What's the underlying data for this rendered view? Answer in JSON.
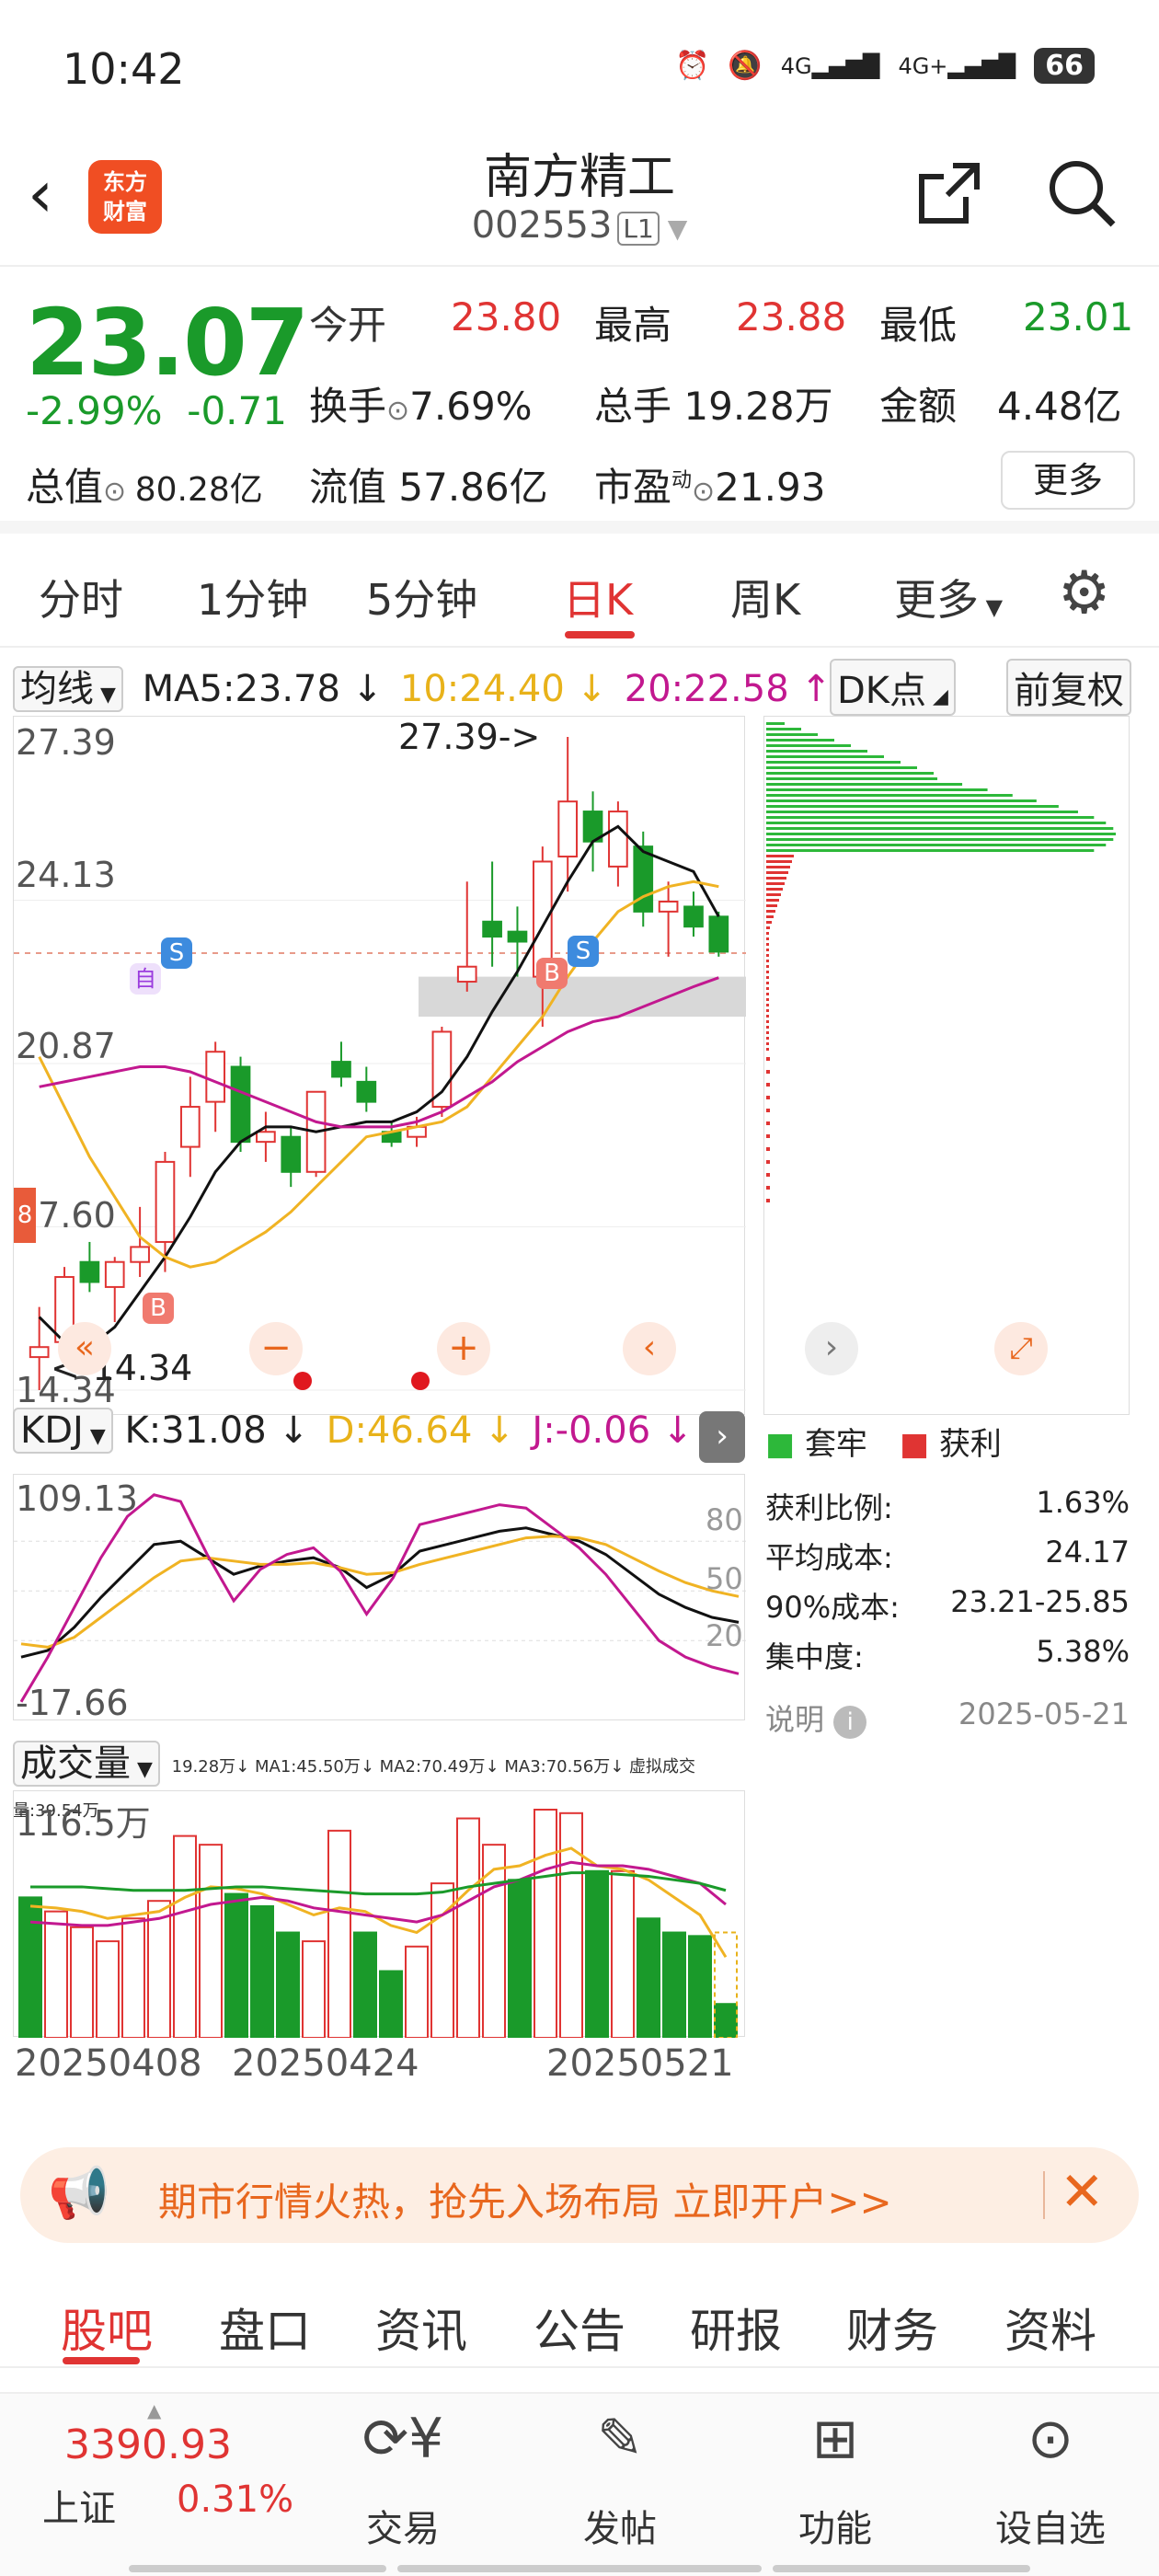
{
  "status_bar": {
    "time": "10:42",
    "signal1": "4G",
    "signal2": "4G+",
    "battery": "66"
  },
  "header": {
    "logo_text": "东方财富",
    "name": "南方精工",
    "code": "002553",
    "level": "L1"
  },
  "quote": {
    "price": "23.07",
    "change_pct": "-2.99%",
    "change": "-0.71",
    "open_label": "今开",
    "open": "23.80",
    "high_label": "最高",
    "high": "23.88",
    "low_label": "最低",
    "low": "23.01",
    "turnover_label": "换手",
    "turnover": "7.69%",
    "volume_label": "总手",
    "volume": "19.28万",
    "amount_label": "金额",
    "amount": "4.48亿",
    "mktcap_label": "总值",
    "mktcap": "80.28亿",
    "float_label": "流值",
    "float": "57.86亿",
    "pe_label": "市盈",
    "pe_sup": "动",
    "pe": "21.93",
    "more": "更多"
  },
  "tabs": [
    "分时",
    "1分钟",
    "5分钟",
    "日K",
    "周K",
    "更多"
  ],
  "active_tab": "日K",
  "ma_bar": {
    "selector": "均线",
    "ma5": "MA5:23.78 ↓",
    "ma10": "10:24.40 ↓",
    "ma20": "20:22.58 ↑",
    "dk": "DK点",
    "adjust": "前复权"
  },
  "kline": {
    "y_labels": [
      "27.39",
      "24.13",
      "20.87",
      "17.60",
      "14.34"
    ],
    "max_marker": "27.39->",
    "min_marker": "<-14.34",
    "markers": [
      "S",
      "B",
      "B",
      "S",
      "自"
    ],
    "side_label": "8"
  },
  "kdj_bar": {
    "selector": "KDJ",
    "k": "K:31.08 ↓",
    "d": "D:46.64 ↓",
    "j": "J:-0.06 ↓"
  },
  "kdj": {
    "y_top": "109.13",
    "y_bottom": "-17.66",
    "levels": [
      "80",
      "50",
      "20"
    ]
  },
  "vol_bar": {
    "selector": "成交量",
    "info": "19.28万↓  MA1:45.50万↓  MA2:70.49万↓  MA3:70.56万↓  虚拟成交量:39.54万"
  },
  "volume": {
    "y_top": "116.5万",
    "dates": [
      "20250408",
      "20250424",
      "20250521"
    ]
  },
  "chips": {
    "legend_trapped": "套牢",
    "legend_profit": "获利",
    "rows": [
      {
        "label": "获利比例:",
        "value": "1.63%"
      },
      {
        "label": "平均成本:",
        "value": "24.17"
      },
      {
        "label": "90%成本:",
        "value": "23.21-25.85"
      },
      {
        "label": "集中度:",
        "value": "5.38%"
      }
    ],
    "note_label": "说明",
    "date": "2025-05-21"
  },
  "banner": {
    "text": "期市行情火热，抢先入场布局 立即开户>>"
  },
  "bottom_tabs": [
    "股吧",
    "盘口",
    "资讯",
    "公告",
    "研报",
    "财务",
    "资料"
  ],
  "bottom_nav": {
    "index_value": "3390.93",
    "index_name": "上证",
    "index_pct": "0.31%",
    "items": [
      "交易",
      "发帖",
      "功能",
      "设自选"
    ]
  },
  "colors": {
    "up": "#e03433",
    "down": "#1a9a2a",
    "accent": "#e03433",
    "banner_text": "#e8671e"
  },
  "chart_data": {
    "type": "candlestick",
    "dates_shown": [
      "20250408",
      "20250424",
      "20250521"
    ],
    "y_range": [
      14.34,
      27.39
    ],
    "candles": [
      {
        "o": 15.2,
        "h": 16.0,
        "l": 14.34,
        "c": 15.0,
        "up": true
      },
      {
        "o": 15.3,
        "h": 16.8,
        "l": 14.9,
        "c": 16.6,
        "up": true
      },
      {
        "o": 16.9,
        "h": 17.3,
        "l": 16.3,
        "c": 16.5,
        "up": false
      },
      {
        "o": 16.4,
        "h": 17.0,
        "l": 15.7,
        "c": 16.9,
        "up": true
      },
      {
        "o": 16.9,
        "h": 18.0,
        "l": 16.6,
        "c": 17.2,
        "up": true
      },
      {
        "o": 17.3,
        "h": 19.1,
        "l": 16.7,
        "c": 18.9,
        "up": true
      },
      {
        "o": 19.2,
        "h": 20.6,
        "l": 18.6,
        "c": 20.0,
        "up": true
      },
      {
        "o": 20.1,
        "h": 21.3,
        "l": 19.5,
        "c": 21.1,
        "up": true
      },
      {
        "o": 20.8,
        "h": 21.0,
        "l": 19.1,
        "c": 19.3,
        "up": false
      },
      {
        "o": 19.3,
        "h": 19.9,
        "l": 18.9,
        "c": 19.5,
        "up": true
      },
      {
        "o": 19.4,
        "h": 19.6,
        "l": 18.4,
        "c": 18.7,
        "up": false
      },
      {
        "o": 18.7,
        "h": 20.0,
        "l": 18.6,
        "c": 20.3,
        "up": true
      },
      {
        "o": 20.9,
        "h": 21.3,
        "l": 20.4,
        "c": 20.6,
        "up": false
      },
      {
        "o": 20.5,
        "h": 20.8,
        "l": 19.9,
        "c": 20.1,
        "up": false
      },
      {
        "o": 19.5,
        "h": 19.7,
        "l": 19.2,
        "c": 19.3,
        "up": false
      },
      {
        "o": 19.4,
        "h": 19.8,
        "l": 19.2,
        "c": 19.6,
        "up": true
      },
      {
        "o": 20.0,
        "h": 21.6,
        "l": 19.8,
        "c": 21.5,
        "up": true
      },
      {
        "o": 22.5,
        "h": 24.5,
        "l": 22.3,
        "c": 22.8,
        "up": true
      },
      {
        "o": 23.7,
        "h": 24.9,
        "l": 22.8,
        "c": 23.4,
        "up": false
      },
      {
        "o": 23.3,
        "h": 24.0,
        "l": 22.6,
        "c": 23.5,
        "up": false
      },
      {
        "o": 22.6,
        "h": 25.2,
        "l": 21.6,
        "c": 24.9,
        "up": true
      },
      {
        "o": 25.0,
        "h": 27.39,
        "l": 24.3,
        "c": 26.1,
        "up": true
      },
      {
        "o": 25.9,
        "h": 26.3,
        "l": 24.7,
        "c": 25.3,
        "up": false
      },
      {
        "o": 24.8,
        "h": 26.1,
        "l": 24.4,
        "c": 25.9,
        "up": true
      },
      {
        "o": 25.2,
        "h": 25.5,
        "l": 23.6,
        "c": 23.9,
        "up": false
      },
      {
        "o": 23.9,
        "h": 24.5,
        "l": 23.0,
        "c": 24.1,
        "up": true
      },
      {
        "o": 24.0,
        "h": 24.3,
        "l": 23.4,
        "c": 23.6,
        "up": false
      },
      {
        "o": 23.8,
        "h": 23.9,
        "l": 23.0,
        "c": 23.1,
        "up": false
      }
    ],
    "ma_series": [
      {
        "name": "MA5",
        "values": [
          15.8,
          15.3,
          15.2,
          15.6,
          16.3,
          17.0,
          17.8,
          18.7,
          19.3,
          19.6,
          19.6,
          19.5,
          19.6,
          19.7,
          19.7,
          19.9,
          20.3,
          21.0,
          21.9,
          22.7,
          23.6,
          24.5,
          25.3,
          25.6,
          25.1,
          24.9,
          24.7,
          23.8
        ]
      },
      {
        "name": "MA10",
        "values": [
          21.0,
          20.0,
          19.0,
          18.2,
          17.4,
          17.0,
          16.8,
          16.9,
          17.2,
          17.5,
          17.9,
          18.4,
          18.9,
          19.4,
          19.5,
          19.6,
          19.7,
          20.0,
          20.6,
          21.2,
          21.8,
          22.6,
          23.3,
          23.9,
          24.2,
          24.4,
          24.5,
          24.4
        ]
      },
      {
        "name": "MA20",
        "values": [
          20.4,
          20.5,
          20.6,
          20.7,
          20.8,
          20.8,
          20.7,
          20.5,
          20.3,
          20.1,
          19.9,
          19.7,
          19.6,
          19.6,
          19.6,
          19.7,
          19.9,
          20.2,
          20.5,
          20.9,
          21.2,
          21.5,
          21.7,
          21.8,
          22.0,
          22.2,
          22.4,
          22.58
        ]
      }
    ],
    "volume": {
      "y_max_label": "116.5万",
      "bars": [
        {
          "v": 80,
          "up": false
        },
        {
          "v": 72,
          "up": true
        },
        {
          "v": 63,
          "up": true
        },
        {
          "v": 55,
          "up": true
        },
        {
          "v": 68,
          "up": true
        },
        {
          "v": 78,
          "up": true
        },
        {
          "v": 115,
          "up": true
        },
        {
          "v": 110,
          "up": true
        },
        {
          "v": 82,
          "up": false
        },
        {
          "v": 75,
          "up": false
        },
        {
          "v": 60,
          "up": false
        },
        {
          "v": 55,
          "up": true
        },
        {
          "v": 118,
          "up": true
        },
        {
          "v": 60,
          "up": false
        },
        {
          "v": 38,
          "up": false
        },
        {
          "v": 52,
          "up": true
        },
        {
          "v": 88,
          "up": true
        },
        {
          "v": 125,
          "up": true
        },
        {
          "v": 110,
          "up": true
        },
        {
          "v": 90,
          "up": false
        },
        {
          "v": 130,
          "up": true
        },
        {
          "v": 128,
          "up": true
        },
        {
          "v": 95,
          "up": false
        },
        {
          "v": 95,
          "up": true
        },
        {
          "v": 68,
          "up": false
        },
        {
          "v": 60,
          "up": false
        },
        {
          "v": 58,
          "up": false
        },
        {
          "v": 19.28,
          "up": false
        }
      ]
    }
  }
}
